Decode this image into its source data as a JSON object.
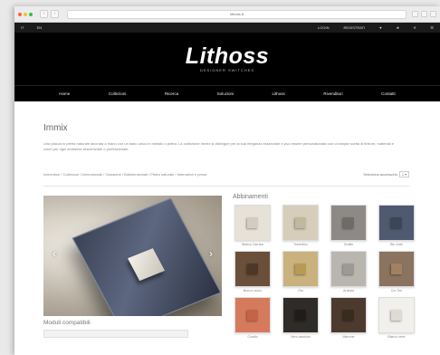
{
  "browser": {
    "url": "lithoss.it",
    "back_label": "‹",
    "forward_label": "›",
    "colors": {
      "close": "#fd5f57",
      "minimize": "#fdbc2e",
      "zoom": "#28c840"
    }
  },
  "topbar": {
    "left": [
      "IT",
      "EN"
    ],
    "right": [
      "LOGIN",
      "REGISTRATI",
      "♥",
      "★",
      "€",
      "☰"
    ]
  },
  "header": {
    "logo": "Lithoss",
    "tagline": "DESIGNER SWITCHES"
  },
  "nav": [
    "Home",
    "Collezioni",
    "Ricerca",
    "Soluzioni",
    "Lithoss",
    "Rivenditori",
    "Contatti"
  ],
  "page": {
    "title": "Immix",
    "description": "Una placca in pietra naturale lavorata a mano con un tasto unico in metallo o pietra. La collezione Immix si distingue per la sua eleganza essenziale e può essere personalizzata con un'ampia scelta di finiture, materiali e colori per ogni ambiente residenziale o professionale.",
    "breadcrumb": "Interruttori / Collezioni / Dimensionali / Classiche / Bidimensionali / Pietra naturale / Interruttori e prese",
    "toolbar_label": "Seleziona accessorio",
    "toolbar_value": "1 ▾"
  },
  "gallery": {
    "prev": "‹",
    "next": "›"
  },
  "variants": {
    "title": "Abbinamenti",
    "items": [
      {
        "label": "Bianco Carrara",
        "plate": "#e6e2d8",
        "knob": "#d3cdbf"
      },
      {
        "label": "Travertino",
        "plate": "#d7cdbb",
        "knob": "#c3b79f"
      },
      {
        "label": "Grafite",
        "plate": "#8c8986",
        "knob": "#6f6b67"
      },
      {
        "label": "Blu notte",
        "plate": "#4f5970",
        "knob": "#3d4558"
      },
      {
        "label": "Bronzo scuro",
        "plate": "#6a4f3a",
        "knob": "#4d3828"
      },
      {
        "label": "Oro",
        "plate": "#c9b27e",
        "knob": "#b89a55"
      },
      {
        "label": "Ardesia",
        "plate": "#b9b6b0",
        "knob": "#9d9a94"
      },
      {
        "label": "Cor-Ten",
        "plate": "#8a735f",
        "knob": "#a28162"
      },
      {
        "label": "Corallo",
        "plate": "#d67a5e",
        "knob": "#c46447"
      },
      {
        "label": "Nero assoluto",
        "plate": "#2e2b28",
        "knob": "#1f1c1a"
      },
      {
        "label": "Marrone",
        "plate": "#4d3a2e",
        "knob": "#3a2b21"
      },
      {
        "label": "Bianco neve",
        "plate": "#f2f0ec",
        "knob": "#dedbd4"
      }
    ]
  },
  "options": {
    "title": "Moduli compatibili"
  }
}
